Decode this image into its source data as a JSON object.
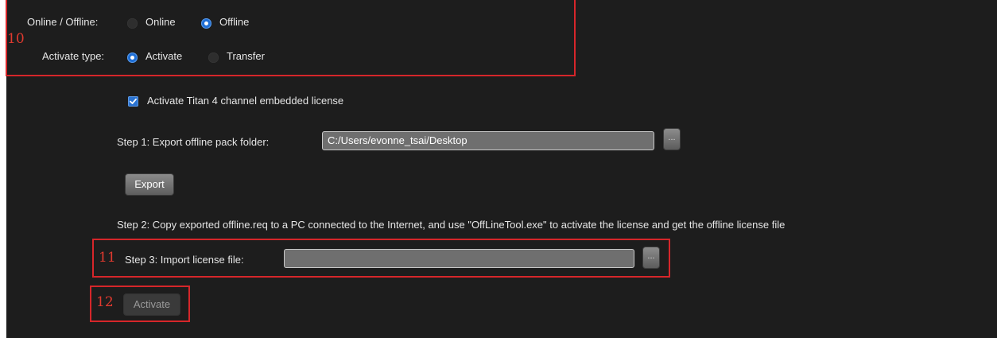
{
  "connection": {
    "label": "Online / Offline:",
    "options": [
      {
        "label": "Online",
        "selected": false
      },
      {
        "label": "Offline",
        "selected": true
      }
    ]
  },
  "activate_type": {
    "label": "Activate type:",
    "options": [
      {
        "label": "Activate",
        "selected": true
      },
      {
        "label": "Transfer",
        "selected": false
      }
    ]
  },
  "embedded_license": {
    "label": "Activate Titan 4 channel embedded license",
    "checked": true
  },
  "step1": {
    "label": "Step 1: Export offline pack folder:",
    "path": "C:/Users/evonne_tsai/Desktop",
    "browse_label": "..."
  },
  "export_button": "Export",
  "step2": {
    "text": "Step 2: Copy exported offline.req to a PC connected to the Internet, and use \"OffLineTool.exe\" to activate the license and get the offline license file"
  },
  "step3": {
    "label": "Step 3: Import license file:",
    "path": "",
    "browse_label": "..."
  },
  "activate_button": "Activate",
  "annotations": {
    "m10": "10",
    "m11": "11",
    "m12": "12"
  },
  "colors": {
    "background": "#1d1d1d",
    "accent": "#1f6fd6",
    "annotation": "#d6262a"
  }
}
